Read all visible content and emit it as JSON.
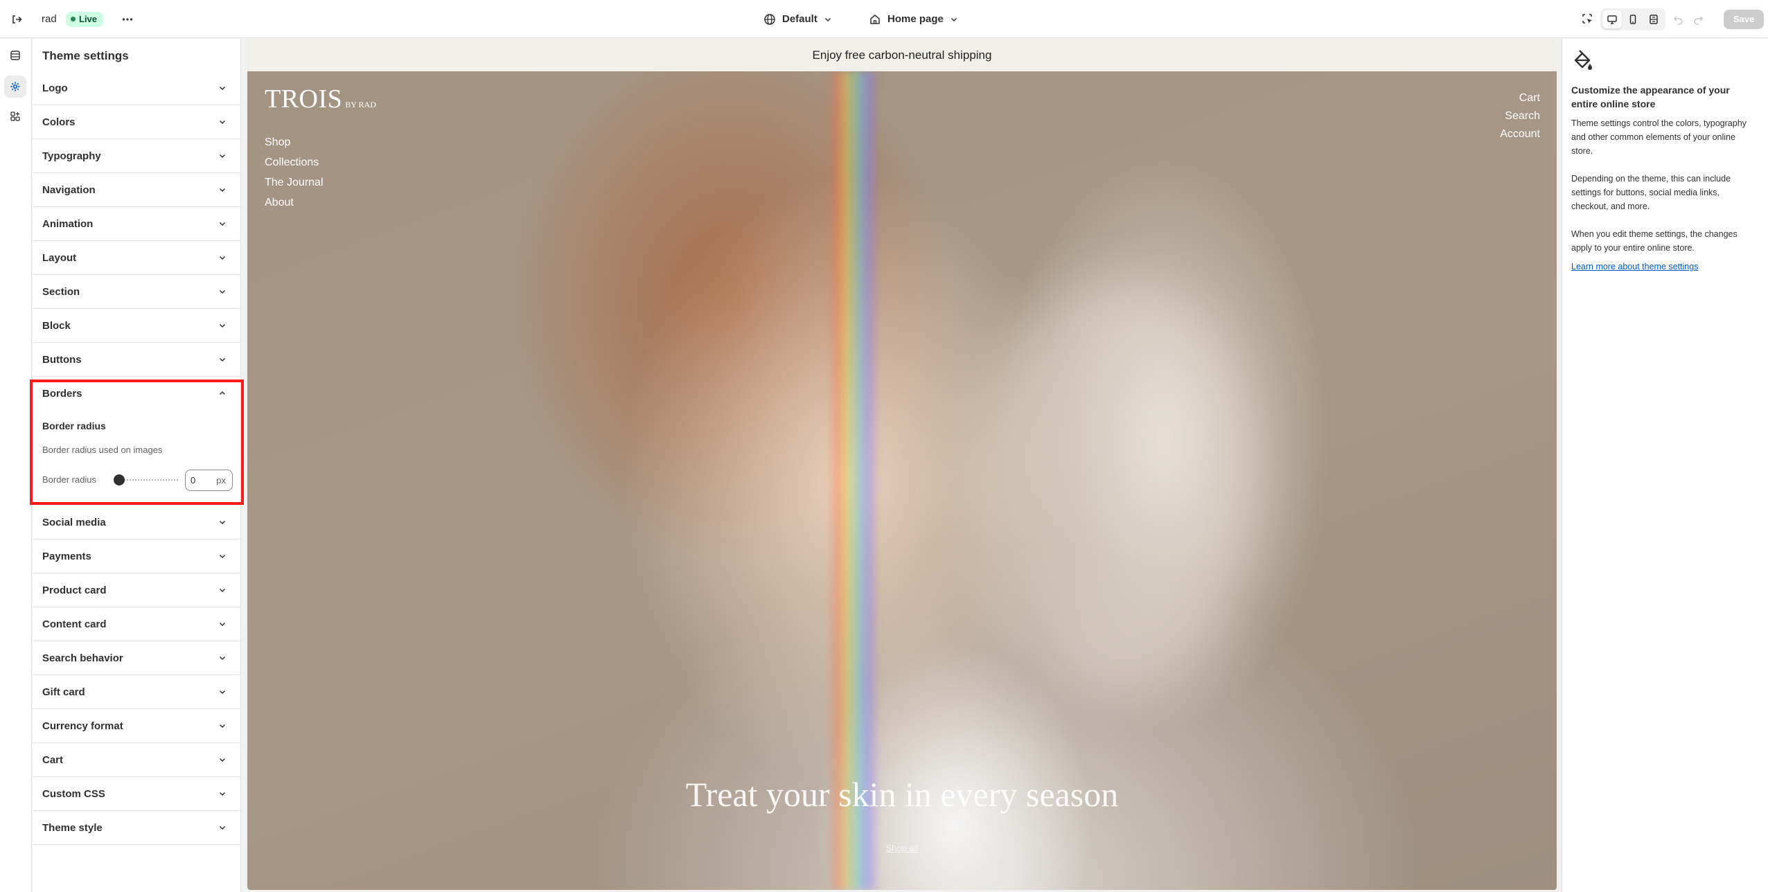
{
  "topbar": {
    "store_name": "rad",
    "status_badge": "Live",
    "theme_select": "Default",
    "page_select": "Home page",
    "save_label": "Save"
  },
  "rail": {
    "items": [
      "sections-icon",
      "theme-settings-icon",
      "apps-icon"
    ],
    "active": "theme-settings-icon"
  },
  "sidebar": {
    "title": "Theme settings",
    "sections_top": [
      "Logo",
      "Colors",
      "Typography",
      "Navigation",
      "Animation",
      "Layout",
      "Section",
      "Block",
      "Buttons"
    ],
    "borders": {
      "label": "Borders",
      "expanded": true,
      "sub_heading": "Border radius",
      "description": "Border radius used on images",
      "range_label": "Border radius",
      "value": "0",
      "unit": "px",
      "slider_fraction": 0
    },
    "sections_bottom": [
      "Social media",
      "Payments",
      "Product card",
      "Content card",
      "Search behavior",
      "Gift card",
      "Currency format",
      "Cart",
      "Custom CSS",
      "Theme style"
    ]
  },
  "preview": {
    "announcement": "Enjoy free carbon-neutral shipping",
    "logo_main": "TROIS",
    "logo_sub": "BY RAD",
    "nav_left": [
      "Shop",
      "Collections",
      "The Journal",
      "About"
    ],
    "nav_right": [
      "Cart",
      "Search",
      "Account"
    ],
    "headline": "Treat your skin in every season",
    "cta": "Shop all"
  },
  "info": {
    "title": "Customize the appearance of your entire online store",
    "p1": "Theme settings control the colors, typography and other common elements of your online store.",
    "p2": "Depending on the theme, this can include settings for buttons, social media links, checkout, and more.",
    "p3": "When you edit theme settings, the changes apply to your entire online store.",
    "link": "Learn more about theme settings"
  },
  "colors": {
    "highlight": "#ff1a1a",
    "live_badge_bg": "#cdfee1",
    "link": "#005bd3"
  }
}
